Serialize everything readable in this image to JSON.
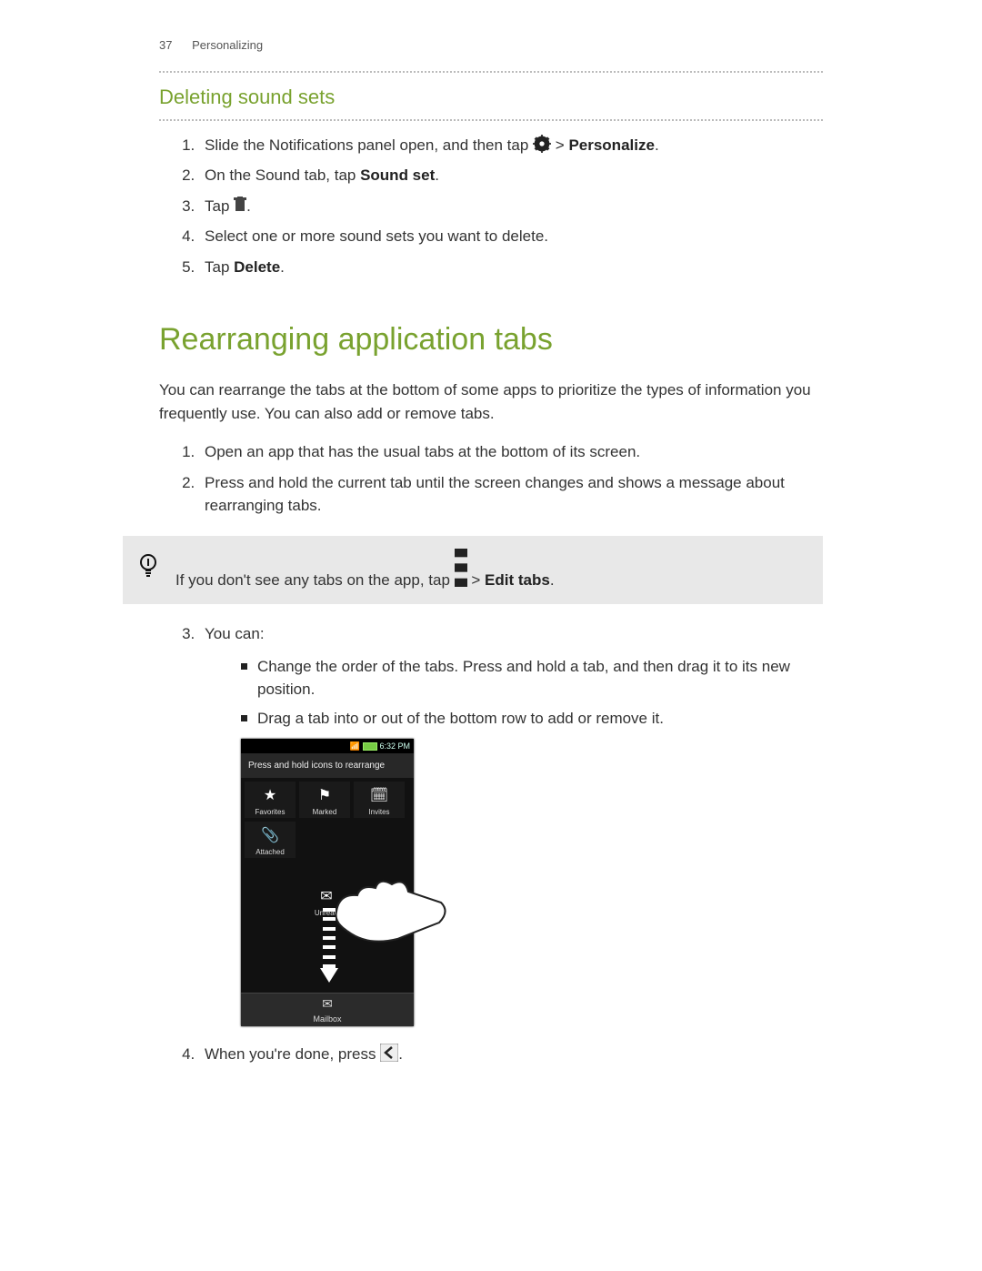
{
  "header": {
    "page_number": "37",
    "section": "Personalizing"
  },
  "section1": {
    "title": "Deleting sound sets",
    "steps": {
      "s1a": "Slide the Notifications panel open, and then tap ",
      "s1b": " > ",
      "s1c": "Personalize",
      "s1d": ".",
      "s2a": "On the Sound tab, tap ",
      "s2b": "Sound set",
      "s2c": ".",
      "s3a": "Tap ",
      "s3b": ".",
      "s4": "Select one or more sound sets you want to delete.",
      "s5a": "Tap ",
      "s5b": "Delete",
      "s5c": "."
    }
  },
  "section2": {
    "title": "Rearranging application tabs",
    "intro": "You can rearrange the tabs at the bottom of some apps to prioritize the types of information you frequently use. You can also add or remove tabs.",
    "steps_top": {
      "s1": "Open an app that has the usual tabs at the bottom of its screen.",
      "s2": "Press and hold the current tab until the screen changes and shows a message about rearranging tabs."
    },
    "tip": {
      "a": "If you don't see any tabs on the app, tap ",
      "b": " > ",
      "c": "Edit tabs",
      "d": "."
    },
    "steps_mid": {
      "s3": "You can:",
      "b1": "Change the order of the tabs. Press and hold a tab, and then drag it to its new position.",
      "b2": "Drag a tab into or out of the bottom row to add or remove it."
    },
    "steps_end": {
      "s4a": "When you're done, press ",
      "s4b": "."
    }
  },
  "phone": {
    "time": "6:32 PM",
    "hint": "Press and hold icons to rearrange",
    "tabs": {
      "favorites": "Favorites",
      "marked": "Marked",
      "invites": "Invites",
      "attached": "Attached",
      "unread": "Unread",
      "mailbox": "Mailbox"
    }
  }
}
